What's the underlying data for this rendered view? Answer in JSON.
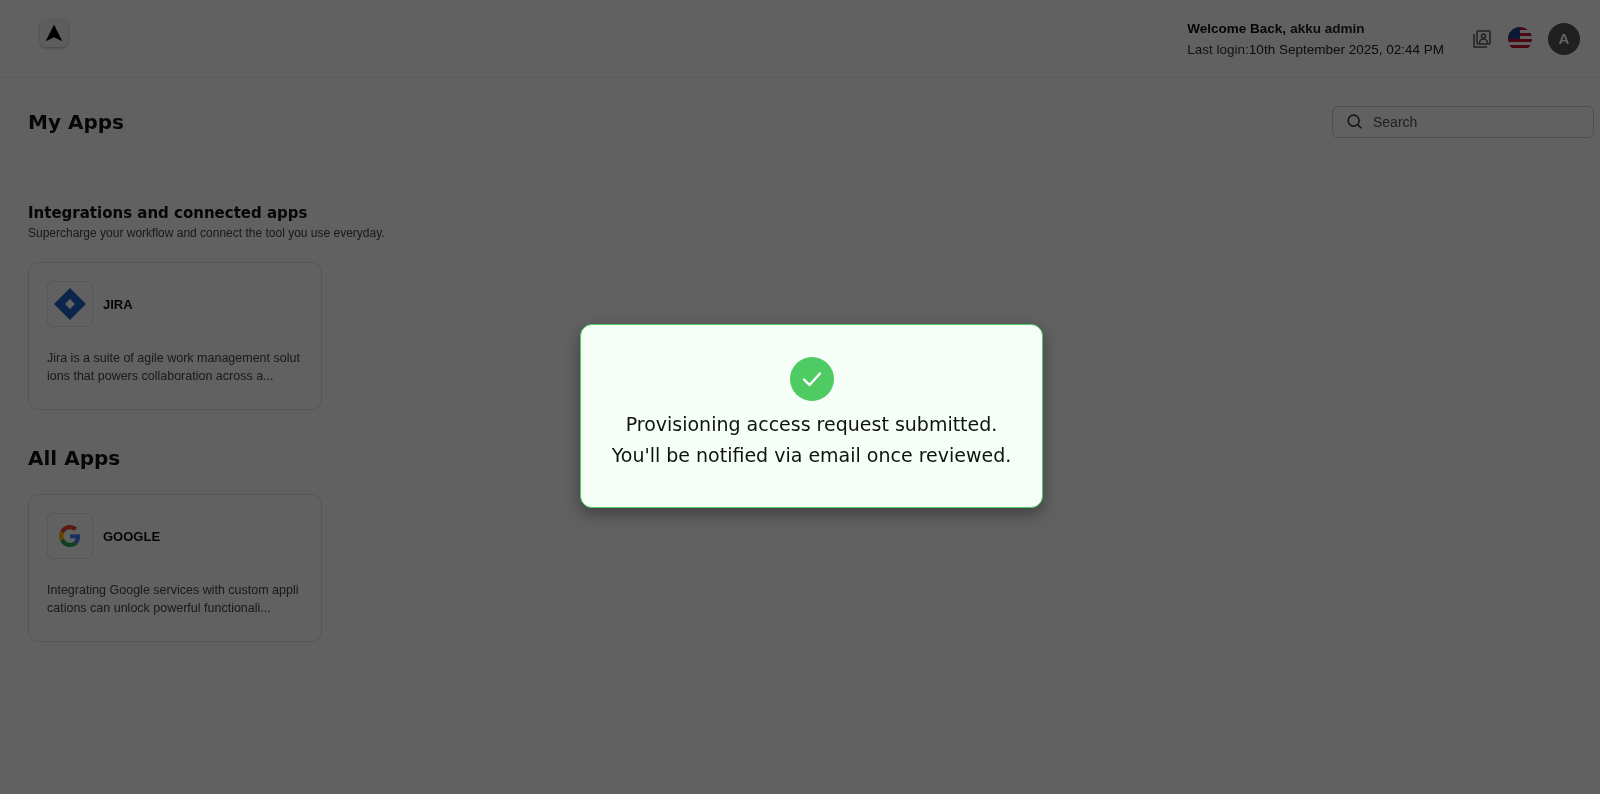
{
  "header": {
    "welcome_label": "Welcome Back,",
    "user_name": "akku admin",
    "last_login_label": "Last login:",
    "last_login_value": "10th September 2025, 02:44 PM",
    "avatar_initial": "A"
  },
  "page": {
    "title": "My Apps",
    "search": {
      "placeholder": "Search"
    }
  },
  "sections": [
    {
      "title": "Integrations and connected apps",
      "subtitle": "Supercharge your workflow and connect the tool you use everyday.",
      "apps": [
        {
          "kind": "jira",
          "name": "JIRA",
          "description": "Jira is a suite of agile work management solutions that powers collaboration across a..."
        }
      ]
    },
    {
      "title": "All Apps",
      "apps": [
        {
          "kind": "google",
          "name": "GOOGLE",
          "description": "Integrating Google services with custom applications can unlock powerful functionali..."
        }
      ]
    }
  ],
  "modal": {
    "lines": [
      "Provisioning access request submitted.",
      "You'll be notified via email once reviewed."
    ]
  }
}
